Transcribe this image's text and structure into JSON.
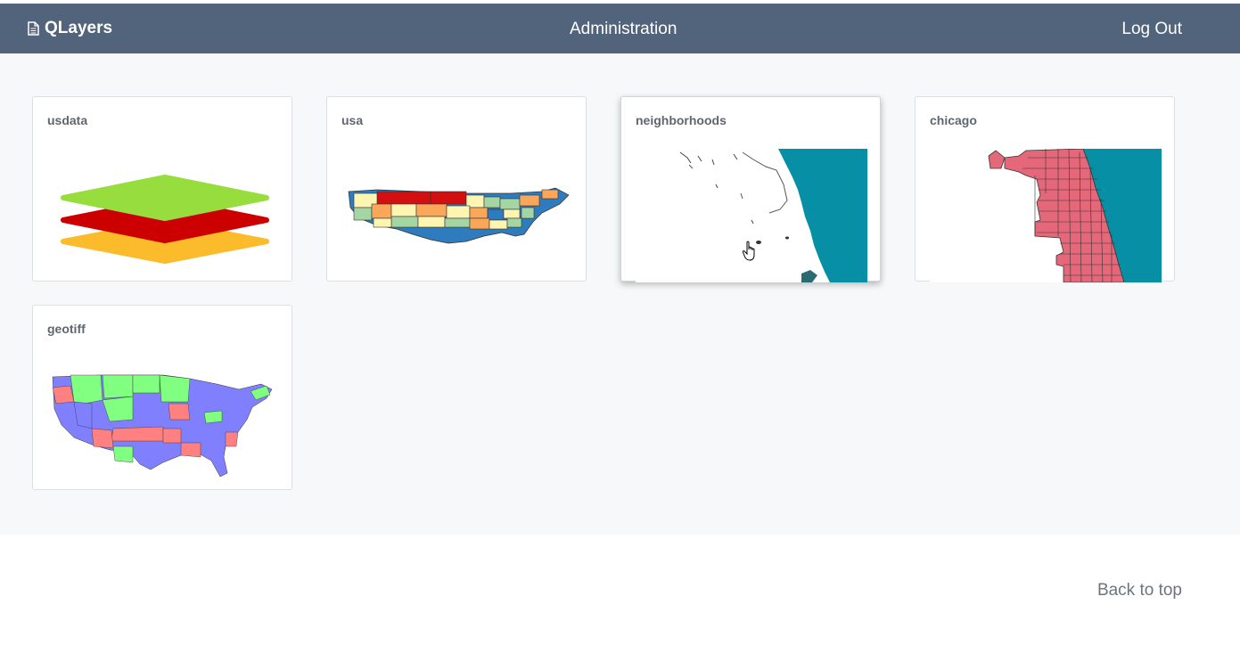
{
  "navbar": {
    "brand": "QLayers",
    "brand_icon": "document-icon",
    "admin_label": "Administration",
    "logout_label": "Log Out",
    "background": "#52647b"
  },
  "cards": [
    {
      "title": "usdata",
      "thumbnail": "layers-stack-icon"
    },
    {
      "title": "usa",
      "thumbnail": "usa-states-map"
    },
    {
      "title": "neighborhoods",
      "thumbnail": "chicago-shoreline-map"
    },
    {
      "title": "chicago",
      "thumbnail": "chicago-neighborhoods-map"
    },
    {
      "title": "geotiff",
      "thumbnail": "usa-geotiff-map"
    }
  ],
  "footer": {
    "back_to_top": "Back to top"
  },
  "colors": {
    "layer_top": "#97dd3e",
    "layer_middle": "#cc0000",
    "layer_bottom": "#fbbb2a",
    "water": "#078fa6",
    "chicago_fill": "#e5687a",
    "geotiff_blue": "#8080ff",
    "geotiff_green": "#80ff80",
    "geotiff_red": "#ff8080"
  }
}
